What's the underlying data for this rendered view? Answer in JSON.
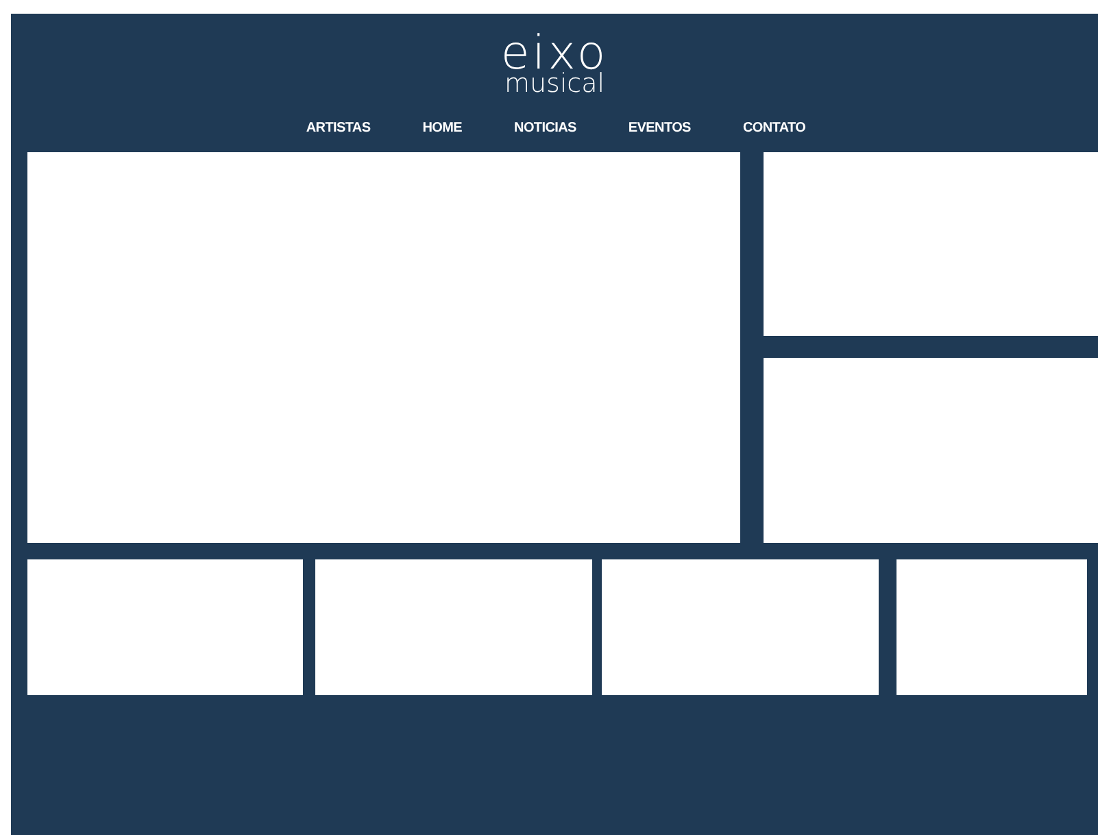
{
  "logo": {
    "line_1": "eixo",
    "line_2": "musical"
  },
  "nav": [
    {
      "label": "ARTISTAS"
    },
    {
      "label": "HOME"
    },
    {
      "label": "NOTICIAS"
    },
    {
      "label": "EVENTOS"
    },
    {
      "label": "CONTATO"
    }
  ]
}
